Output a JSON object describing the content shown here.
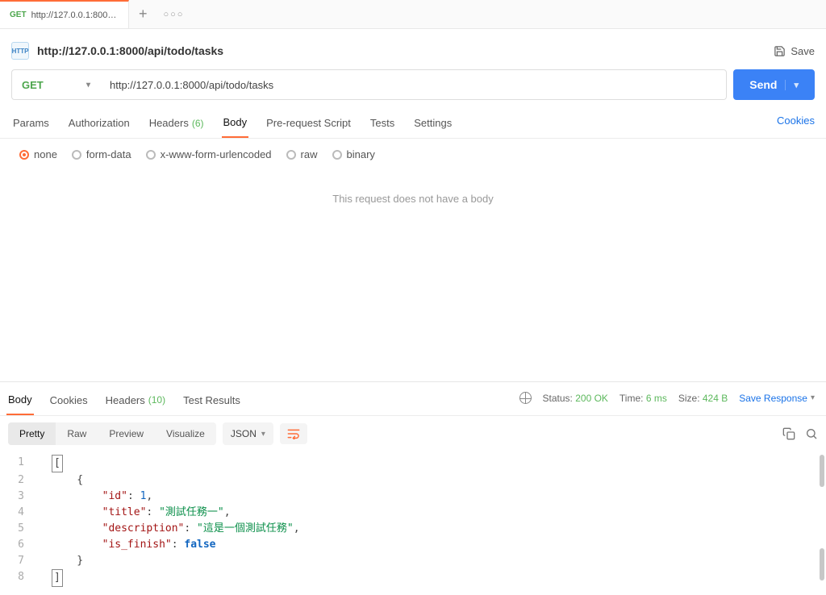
{
  "tab": {
    "method": "GET",
    "label": "http://127.0.0.1:8000/api/t"
  },
  "header": {
    "title": "http://127.0.0.1:8000/api/todo/tasks",
    "save": "Save"
  },
  "request": {
    "method": "GET",
    "url": "http://127.0.0.1:8000/api/todo/tasks",
    "send": "Send"
  },
  "reqtabs": {
    "params": "Params",
    "auth": "Authorization",
    "headers": "Headers",
    "headers_cnt": "(6)",
    "body": "Body",
    "prereq": "Pre-request Script",
    "tests": "Tests",
    "settings": "Settings",
    "cookies": "Cookies"
  },
  "bodytypes": {
    "none": "none",
    "form": "form-data",
    "xwww": "x-www-form-urlencoded",
    "raw": "raw",
    "binary": "binary"
  },
  "body_empty": "This request does not have a body",
  "resptabs": {
    "body": "Body",
    "cookies": "Cookies",
    "headers": "Headers",
    "headers_cnt": "(10)",
    "tests": "Test Results"
  },
  "respmeta": {
    "status_lbl": "Status:",
    "status_val": "200 OK",
    "time_lbl": "Time:",
    "time_val": "6 ms",
    "size_lbl": "Size:",
    "size_val": "424 B",
    "save": "Save Response"
  },
  "viewer": {
    "pretty": "Pretty",
    "raw": "Raw",
    "preview": "Preview",
    "visualize": "Visualize",
    "lang": "JSON"
  },
  "json": {
    "l1": "[",
    "l2": "    {",
    "l3a": "        ",
    "l3k": "\"id\"",
    "l3v": "1",
    "l4a": "        ",
    "l4k": "\"title\"",
    "l4v": "\"測試任務一\"",
    "l5a": "        ",
    "l5k": "\"description\"",
    "l5v": "\"這是一個測試任務\"",
    "l6a": "        ",
    "l6k": "\"is_finish\"",
    "l6v": "false",
    "l7": "    }",
    "l8": "]"
  }
}
